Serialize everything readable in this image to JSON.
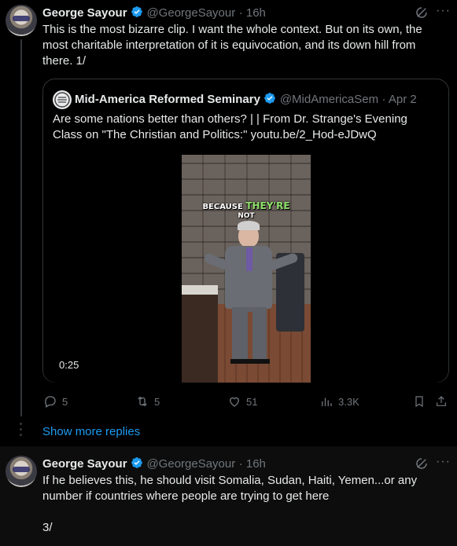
{
  "tweet1": {
    "author_name": "George Sayour",
    "handle": "@GeorgeSayour",
    "time": "· 16h",
    "text_lines": [
      "This is the most bizarre clip. I want the whole context. But on its own, the",
      "most charitable interpretation of it is equivocation, and its down hill from",
      "there. 1/"
    ],
    "more_icon": "more-dots-icon",
    "grok_icon": "grok-icon"
  },
  "quote": {
    "author_name": "Mid-America Reformed Seminary",
    "handle": "@MidAmericaSem",
    "time": "· Apr 2",
    "text_lines": [
      "Are some nations better than others? |  | From Dr. Strange's Evening",
      "Class on \"The Christian and Politics:\" youtu.be/2_Hod-eJDwQ"
    ],
    "video": {
      "duration": "0:25",
      "caption_word1": "BECAUSE",
      "caption_word2": "THEY'RE",
      "caption_word3": "NOT"
    }
  },
  "actions": {
    "replies": "5",
    "reposts": "5",
    "likes": "51",
    "views": "3.3K"
  },
  "show_more": "Show more replies",
  "tweet3": {
    "author_name": "George Sayour",
    "handle": "@GeorgeSayour",
    "time": "· 16h",
    "text_lines": [
      "If he believes this, he should visit Somalia, Sudan, Haiti, Yemen...or any",
      "number if countries where people are trying to get here",
      "",
      "3/"
    ]
  },
  "colors": {
    "background": "#000000",
    "text": "#e7e9ea",
    "muted": "#71767b",
    "accent": "#1d9bf0",
    "caption_green": "#8ee06a"
  }
}
